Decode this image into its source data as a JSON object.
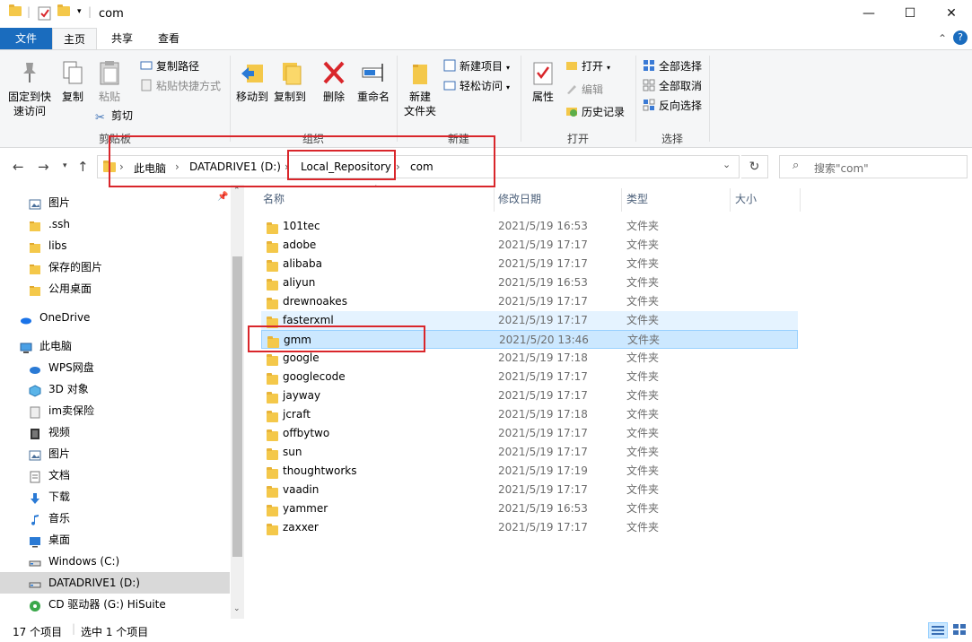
{
  "window": {
    "title": "com",
    "controls": {
      "minimize": "—",
      "maximize": "☐",
      "close": "✕"
    }
  },
  "ribbon_tabs": {
    "file": "文件",
    "home": "主页",
    "share": "共享",
    "view": "查看"
  },
  "ribbon": {
    "clipboard": {
      "pin": "固定到快\n速访问",
      "copy": "复制",
      "paste": "粘贴",
      "copy_path": "复制路径",
      "paste_shortcut": "粘贴快捷方式",
      "cut": "剪切",
      "label": "剪贴板"
    },
    "organize": {
      "move_to": "移动到",
      "copy_to": "复制到",
      "delete": "删除",
      "rename": "重命名",
      "label": "组织"
    },
    "new": {
      "new_folder": "新建\n文件夹",
      "new_item": "新建项目",
      "easy_access": "轻松访问",
      "label": "新建"
    },
    "open": {
      "properties": "属性",
      "open": "打开",
      "edit": "编辑",
      "history": "历史记录",
      "label": "打开"
    },
    "select": {
      "select_all": "全部选择",
      "select_none": "全部取消",
      "invert": "反向选择",
      "label": "选择"
    }
  },
  "address": {
    "crumbs": [
      "此电脑",
      "DATADRIVE1 (D:)",
      "Local_Repository",
      "com"
    ],
    "search_placeholder": "搜索\"com\""
  },
  "nav_pane": {
    "items": [
      {
        "label": "图片",
        "icon": "pictures-icon"
      },
      {
        "label": ".ssh",
        "icon": "folder-icon"
      },
      {
        "label": "libs",
        "icon": "folder-icon"
      },
      {
        "label": "保存的图片",
        "icon": "folder-icon"
      },
      {
        "label": "公用桌面",
        "icon": "folder-icon"
      },
      {
        "label": "OneDrive",
        "icon": "onedrive-icon"
      },
      {
        "label": "此电脑",
        "icon": "computer-icon"
      },
      {
        "label": "WPS网盘",
        "icon": "cloud-icon"
      },
      {
        "label": "3D 对象",
        "icon": "cube-icon"
      },
      {
        "label": "im卖保险",
        "icon": "app-icon"
      },
      {
        "label": "视频",
        "icon": "video-icon"
      },
      {
        "label": "图片",
        "icon": "pictures-icon"
      },
      {
        "label": "文档",
        "icon": "document-icon"
      },
      {
        "label": "下载",
        "icon": "download-icon"
      },
      {
        "label": "音乐",
        "icon": "music-icon"
      },
      {
        "label": "桌面",
        "icon": "desktop-icon"
      },
      {
        "label": "Windows (C:)",
        "icon": "drive-icon"
      },
      {
        "label": "DATADRIVE1 (D:)",
        "icon": "drive-icon"
      },
      {
        "label": "CD 驱动器 (G:) HiSuite",
        "icon": "cd-icon"
      }
    ]
  },
  "file_list": {
    "columns": {
      "name": "名称",
      "date": "修改日期",
      "type": "类型",
      "size": "大小"
    },
    "rows": [
      {
        "name": "101tec",
        "date": "2021/5/19 16:53",
        "type": "文件夹"
      },
      {
        "name": "adobe",
        "date": "2021/5/19 17:17",
        "type": "文件夹"
      },
      {
        "name": "alibaba",
        "date": "2021/5/19 17:17",
        "type": "文件夹"
      },
      {
        "name": "aliyun",
        "date": "2021/5/19 16:53",
        "type": "文件夹"
      },
      {
        "name": "drewnoakes",
        "date": "2021/5/19 17:17",
        "type": "文件夹"
      },
      {
        "name": "fasterxml",
        "date": "2021/5/19 17:17",
        "type": "文件夹"
      },
      {
        "name": "gmm",
        "date": "2021/5/20 13:46",
        "type": "文件夹"
      },
      {
        "name": "google",
        "date": "2021/5/19 17:18",
        "type": "文件夹"
      },
      {
        "name": "googlecode",
        "date": "2021/5/19 17:17",
        "type": "文件夹"
      },
      {
        "name": "jayway",
        "date": "2021/5/19 17:17",
        "type": "文件夹"
      },
      {
        "name": "jcraft",
        "date": "2021/5/19 17:18",
        "type": "文件夹"
      },
      {
        "name": "offbytwo",
        "date": "2021/5/19 17:17",
        "type": "文件夹"
      },
      {
        "name": "sun",
        "date": "2021/5/19 17:17",
        "type": "文件夹"
      },
      {
        "name": "thoughtworks",
        "date": "2021/5/19 17:19",
        "type": "文件夹"
      },
      {
        "name": "vaadin",
        "date": "2021/5/19 17:17",
        "type": "文件夹"
      },
      {
        "name": "yammer",
        "date": "2021/5/19 16:53",
        "type": "文件夹"
      },
      {
        "name": "zaxxer",
        "date": "2021/5/19 17:17",
        "type": "文件夹"
      }
    ]
  },
  "status": {
    "item_count": "17 个项目",
    "selected": "选中 1 个项目"
  },
  "colors": {
    "accent": "#1a6cbe",
    "annotation": "#d9262b",
    "selected_row": "#cce8ff",
    "hover_row": "#e5f3ff",
    "folder": "#f4c84a"
  }
}
